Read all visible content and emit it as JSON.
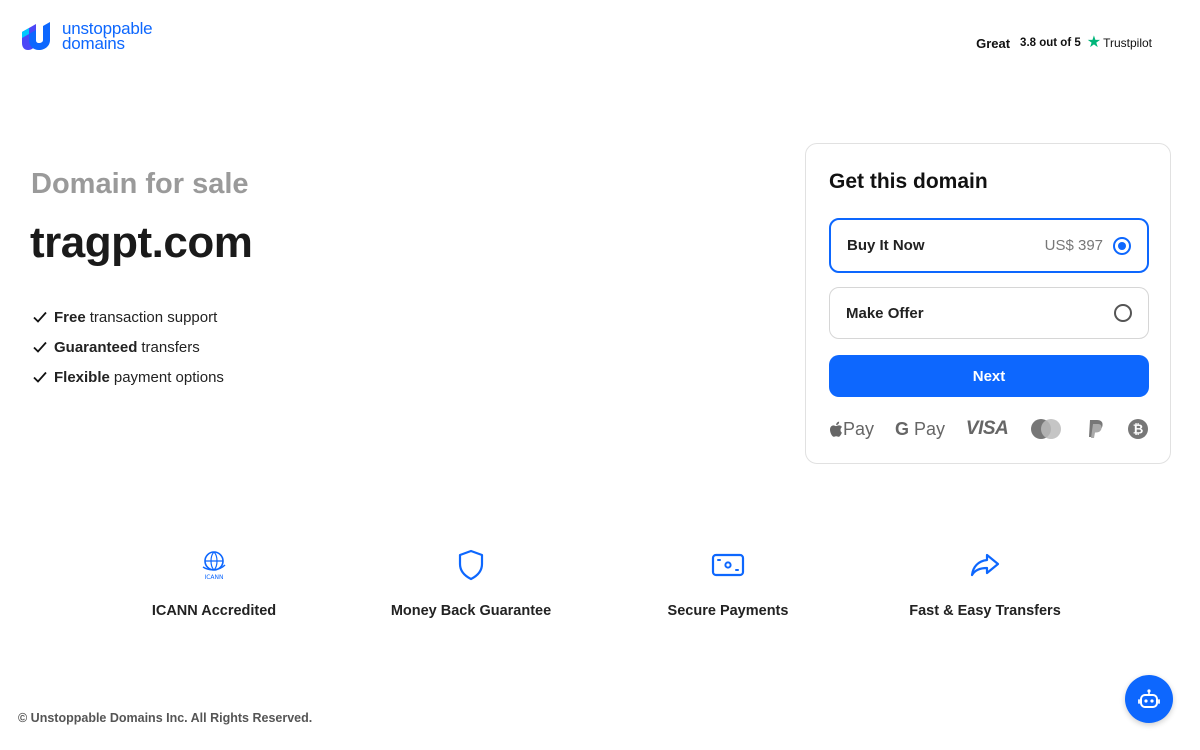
{
  "header": {
    "logo_line1": "unstoppable",
    "logo_line2": "domains",
    "trustpilot_rating": "Great",
    "trustpilot_score": "3.8 out of 5",
    "trustpilot_name": "Trustpilot"
  },
  "hero": {
    "subtitle": "Domain for sale",
    "domain": "tragpt.com",
    "features": [
      {
        "bold": "Free",
        "text": "transaction support"
      },
      {
        "bold": "Guaranteed",
        "text": "transfers"
      },
      {
        "bold": "Flexible",
        "text": "payment options"
      }
    ]
  },
  "card": {
    "title": "Get this domain",
    "options": [
      {
        "label": "Buy It Now",
        "price": "US$ 397",
        "selected": true
      },
      {
        "label": "Make Offer",
        "price": "",
        "selected": false
      }
    ],
    "next_label": "Next",
    "payments": {
      "apple_pay": "Pay",
      "google_pay": "Pay",
      "visa": "VISA"
    }
  },
  "trust_badges": [
    {
      "label": "ICANN Accredited",
      "icon": "icann-icon"
    },
    {
      "label": "Money Back Guarantee",
      "icon": "shield-icon"
    },
    {
      "label": "Secure Payments",
      "icon": "payment-icon"
    },
    {
      "label": "Fast & Easy Transfers",
      "icon": "share-arrow-icon"
    }
  ],
  "footer": {
    "copyright": "© Unstoppable Domains Inc. All Rights Reserved."
  },
  "colors": {
    "accent": "#0d67fe",
    "trustpilot_green": "#00b67a",
    "subtitle_gray": "#9a9a9a"
  }
}
